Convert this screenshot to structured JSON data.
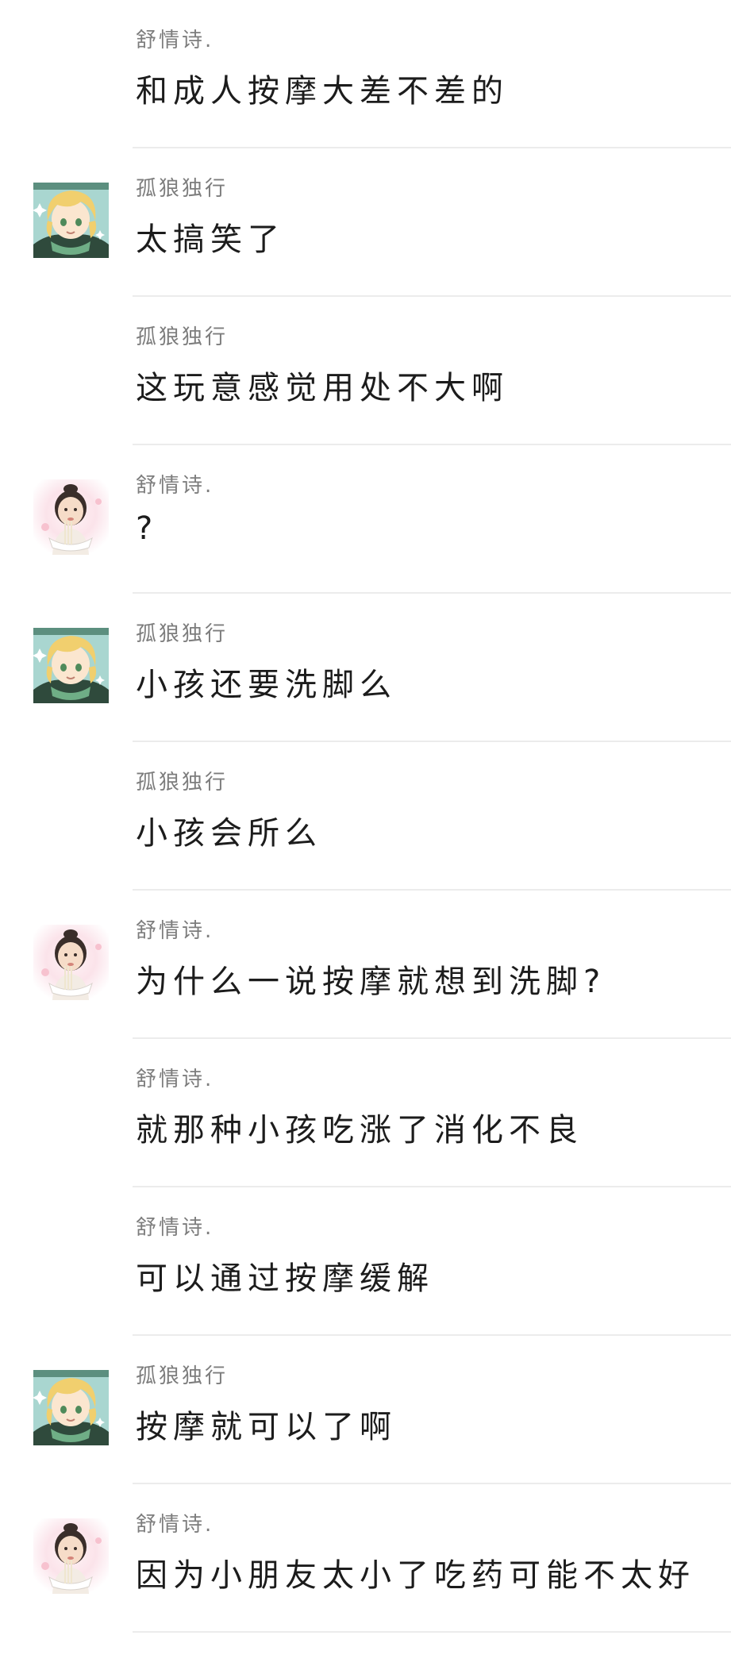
{
  "messages": [
    {
      "sender": "舒情诗.",
      "text": "和成人按摩大差不差的",
      "avatar": "none"
    },
    {
      "sender": "孤狼独行",
      "text": "太搞笑了",
      "avatar": "anime-blond"
    },
    {
      "sender": "孤狼独行",
      "text": "这玩意感觉用处不大啊",
      "avatar": "none"
    },
    {
      "sender": "舒情诗.",
      "text": "?",
      "avatar": "girl-noodles"
    },
    {
      "sender": "孤狼独行",
      "text": "小孩还要洗脚么",
      "avatar": "anime-blond"
    },
    {
      "sender": "孤狼独行",
      "text": "小孩会所么",
      "avatar": "none"
    },
    {
      "sender": "舒情诗.",
      "text": "为什么一说按摩就想到洗脚?",
      "avatar": "girl-noodles"
    },
    {
      "sender": "舒情诗.",
      "text": "就那种小孩吃涨了消化不良",
      "avatar": "none"
    },
    {
      "sender": "舒情诗.",
      "text": "可以通过按摩缓解",
      "avatar": "none"
    },
    {
      "sender": "孤狼独行",
      "text": "按摩就可以了啊",
      "avatar": "anime-blond"
    },
    {
      "sender": "舒情诗.",
      "text": "因为小朋友太小了吃药可能不太好",
      "avatar": "girl-noodles"
    }
  ]
}
